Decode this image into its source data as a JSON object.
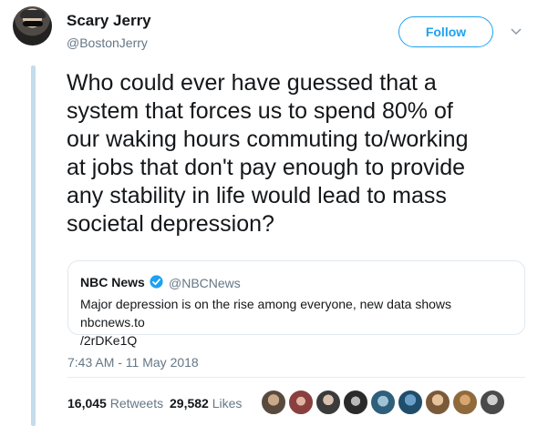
{
  "author": {
    "name": "Scary Jerry",
    "handle": "@BostonJerry"
  },
  "follow_label": "Follow",
  "tweet_text": "Who could ever have guessed that a\nsystem that forces us to spend 80% of\nour waking hours commuting to/working\nat jobs that don't pay enough to provide\nany stability in life would lead to mass\nsocietal depression?",
  "quoted": {
    "name": "NBC News",
    "handle": "@NBCNews",
    "text": "Major depression is on the rise among everyone, new data shows nbcnews.to\n/2rDKe1Q"
  },
  "timestamp": "7:43 AM - 11 May 2018",
  "stats": {
    "retweets_count": "16,045",
    "retweets_label": "Retweets",
    "likes_count": "29,582",
    "likes_label": "Likes"
  },
  "colors": {
    "accent": "#1da1f2",
    "muted": "#657786",
    "thread_line": "#c4dceb"
  },
  "icons": [
    "chevron-down-icon",
    "verified-icon"
  ]
}
